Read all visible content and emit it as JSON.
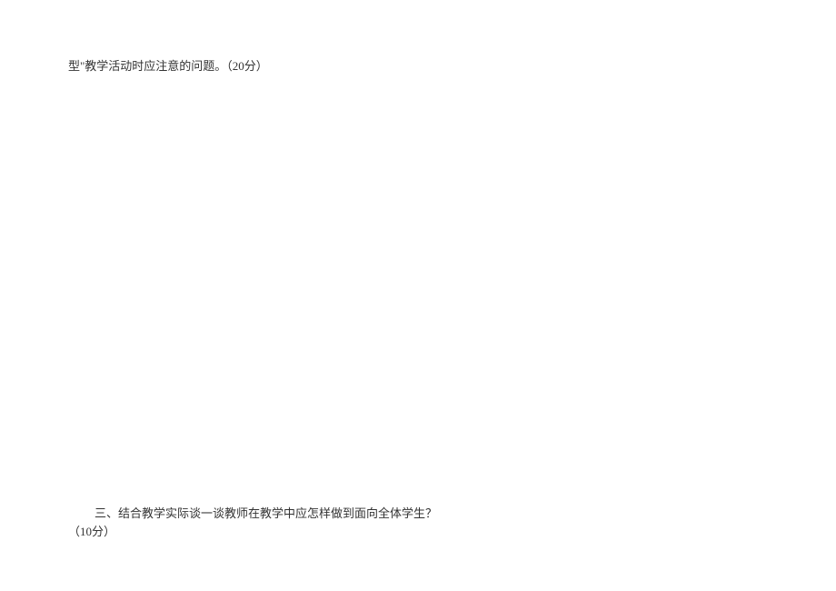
{
  "document": {
    "line1": "型\"教学活动时应注意的问题。（20分）",
    "line2": "三、结合教学实际谈一谈教师在教学中应怎样做到面向全体学生？",
    "line3": "（10分）"
  }
}
